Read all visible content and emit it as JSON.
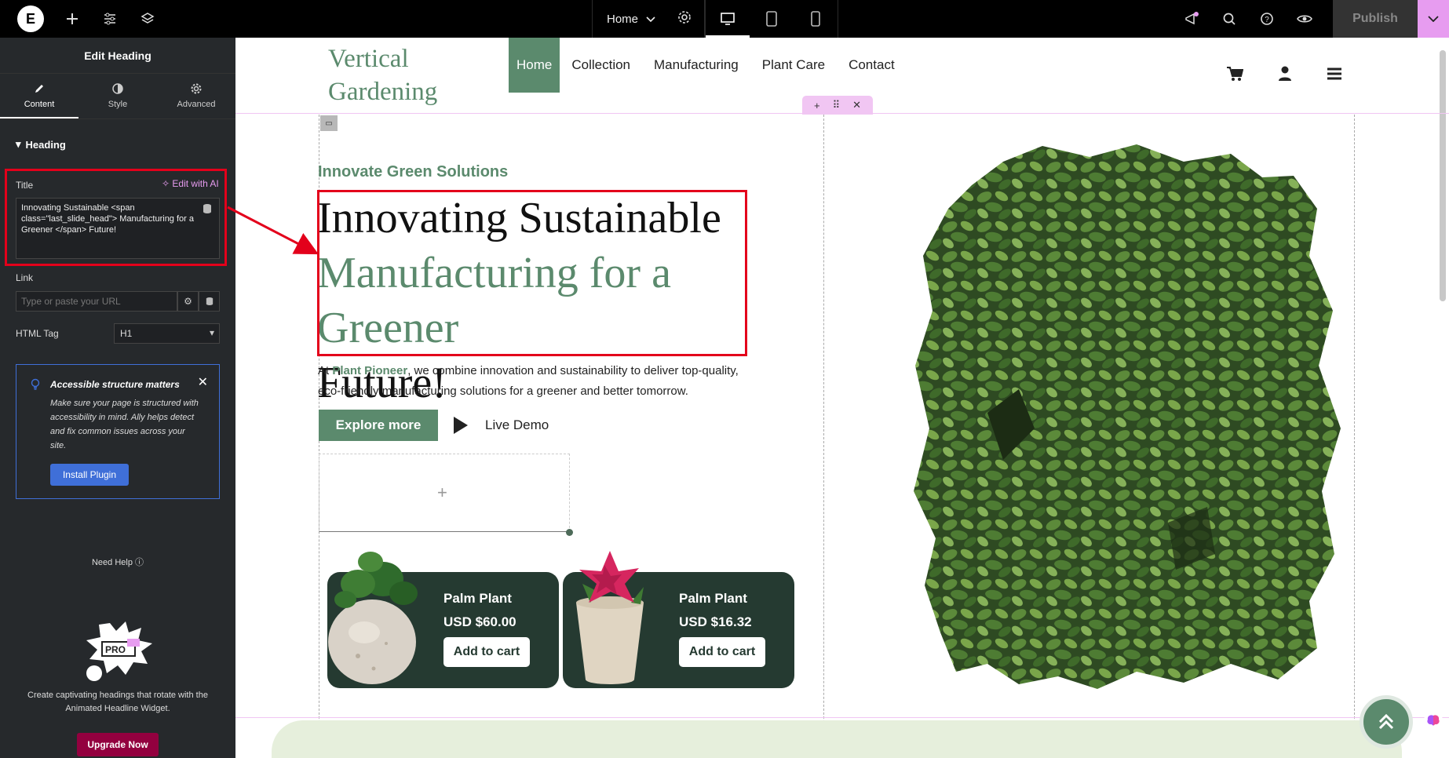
{
  "topbar": {
    "page_name": "Home",
    "publish_label": "Publish"
  },
  "panel": {
    "title": "Edit Heading",
    "tabs": [
      {
        "label": "Content",
        "icon": "pencil-icon"
      },
      {
        "label": "Style",
        "icon": "half-circle-icon"
      },
      {
        "label": "Advanced",
        "icon": "gear-icon"
      }
    ],
    "section_heading": "Heading",
    "title_label": "Title",
    "ai_link": "Edit with AI",
    "title_value": "Innovating Sustainable <span class=\"last_slide_head\"> Manufacturing for a Greener </span> Future!",
    "link_label": "Link",
    "link_placeholder": "Type or paste your URL",
    "html_tag_label": "HTML Tag",
    "html_tag_value": "H1",
    "notice": {
      "title": "Accessible structure matters",
      "text": "Make sure your page is structured with accessibility in mind. Ally helps detect and fix common issues across your site.",
      "button": "Install Plugin"
    },
    "need_help": "Need Help",
    "promo_text": "Create captivating headings that rotate with the Animated Headline Widget.",
    "promo_badge": "PRO",
    "upgrade_button": "Upgrade Now"
  },
  "site": {
    "title": "Vertical Gardening",
    "nav": [
      "Home",
      "Collection",
      "Manufacturing",
      "Plant Care",
      "Contact"
    ],
    "eyebrow": "Innovate Green Solutions",
    "heading_part1": "Innovating Sustainable",
    "heading_green": "Manufacturing for a Greener",
    "heading_part2": "Future!",
    "para_prefix": "At ",
    "para_brand": "Plant Pioneer",
    "para_rest": ", we combine innovation and sustainability to deliver top-quality, eco-friendly manufacturing solutions for a greener and better tomorrow.",
    "explore_button": "Explore more",
    "demo_label": "Live Demo",
    "products": [
      {
        "name": "Palm Plant",
        "price": "USD  $60.00",
        "button": "Add to cart"
      },
      {
        "name": "Palm Plant",
        "price": "USD  $16.32",
        "button": "Add to cart"
      }
    ]
  },
  "colors": {
    "brand_green": "#5b8a6d",
    "card_dark": "#253a31",
    "highlight_red": "#e3001b",
    "editor_pink": "#e79cf0"
  }
}
